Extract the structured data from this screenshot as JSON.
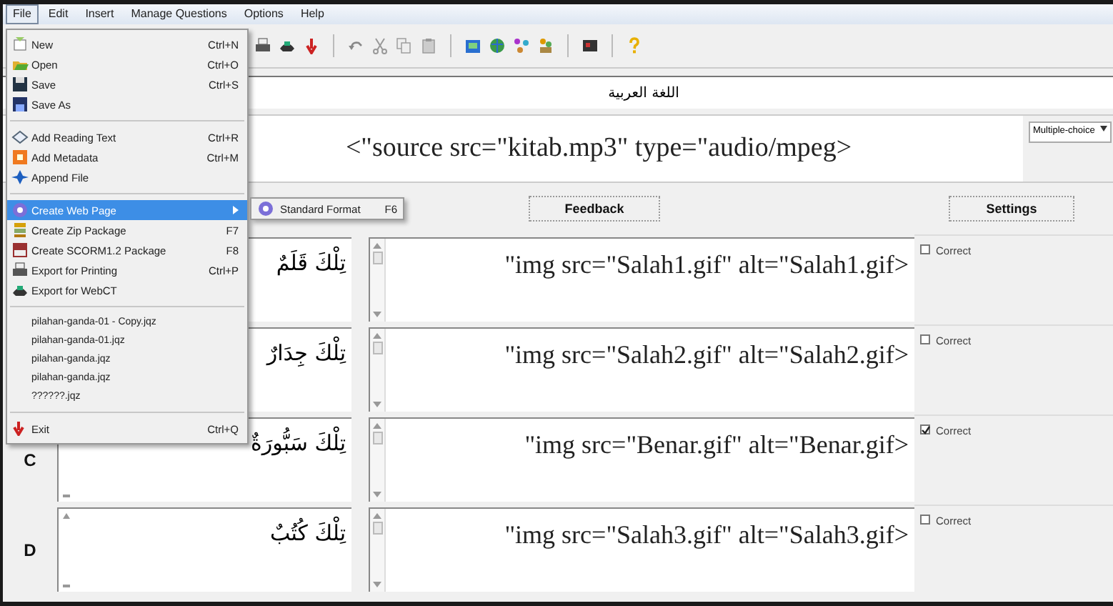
{
  "menu_bar": [
    {
      "label": "File",
      "selected": true
    },
    {
      "label": "Edit",
      "selected": false
    },
    {
      "label": "Insert",
      "selected": false
    },
    {
      "label": "Manage Questions",
      "selected": false
    },
    {
      "label": "Options",
      "selected": false
    },
    {
      "label": "Help",
      "selected": false
    }
  ],
  "title_field": {
    "value": "اللغة العربية"
  },
  "question": {
    "value": "<\"source src=\"kitab.mp3\" type=\"audio/mpeg>",
    "type": "Multiple-choice"
  },
  "headers": {
    "feedback": "Feedback",
    "settings": "Settings"
  },
  "answers": [
    {
      "answer": "تِلْكَ قَلَمٌ",
      "feedback": "\"img src=\"Salah1.gif\" alt=\"Salah1.gif>",
      "correct_label": "Correct",
      "correct": false
    },
    {
      "answer": "تِلْكَ جِدَارٌ",
      "feedback": "\"img src=\"Salah2.gif\" alt=\"Salah2.gif>",
      "correct_label": "Correct",
      "correct": false
    },
    {
      "letter": "C",
      "answer": "تِلْكَ سَبُّورَةٌ",
      "feedback": "\"img src=\"Benar.gif\" alt=\"Benar.gif>",
      "correct_label": "Correct",
      "correct": true
    },
    {
      "letter": "D",
      "answer": "تِلْكَ كُتُبٌ",
      "feedback": "\"img src=\"Salah3.gif\" alt=\"Salah3.gif>",
      "correct_label": "Correct",
      "correct": false
    }
  ],
  "file_menu": [
    {
      "kind": "item",
      "label": "New",
      "shortcut": "Ctrl+N",
      "selected": false,
      "submenu": false
    },
    {
      "kind": "item",
      "label": "Open",
      "shortcut": "Ctrl+O",
      "selected": false,
      "submenu": false
    },
    {
      "kind": "item",
      "label": "Save",
      "shortcut": "Ctrl+S",
      "selected": false,
      "submenu": false
    },
    {
      "kind": "item",
      "label": "Save As",
      "selected": false,
      "submenu": false
    },
    {
      "kind": "separator"
    },
    {
      "kind": "item",
      "label": "Add Reading Text",
      "shortcut": "Ctrl+R",
      "selected": false,
      "submenu": false
    },
    {
      "kind": "item",
      "label": "Add Metadata",
      "shortcut": "Ctrl+M",
      "selected": false,
      "submenu": false
    },
    {
      "kind": "item",
      "label": "Append File",
      "selected": false,
      "submenu": false
    },
    {
      "kind": "separator"
    },
    {
      "kind": "item",
      "label": "Create Web Page",
      "selected": true,
      "submenu": true
    },
    {
      "kind": "item",
      "label": "Create Zip Package",
      "shortcut": "F7",
      "selected": false,
      "submenu": false
    },
    {
      "kind": "item",
      "label": "Create SCORM1.2 Package",
      "shortcut": "F8",
      "selected": false,
      "submenu": false
    },
    {
      "kind": "item",
      "label": "Export for Printing",
      "shortcut": "Ctrl+P",
      "selected": false,
      "submenu": false
    },
    {
      "kind": "item",
      "label": "Export for WebCT",
      "selected": false,
      "submenu": false
    },
    {
      "kind": "separator"
    },
    {
      "kind": "recent",
      "label": "pilahan-ganda-01 - Copy.jqz"
    },
    {
      "kind": "recent",
      "label": "pilahan-ganda-01.jqz"
    },
    {
      "kind": "recent",
      "label": "pilahan-ganda.jqz"
    },
    {
      "kind": "recent",
      "label": "pilahan-ganda.jqz"
    },
    {
      "kind": "recent",
      "label": "??????.jqz"
    },
    {
      "kind": "separator"
    },
    {
      "kind": "item",
      "label": "Exit",
      "shortcut": "Ctrl+Q",
      "selected": false,
      "submenu": false
    }
  ],
  "submenu": [
    {
      "label": "Standard Format",
      "shortcut": "F6"
    }
  ]
}
